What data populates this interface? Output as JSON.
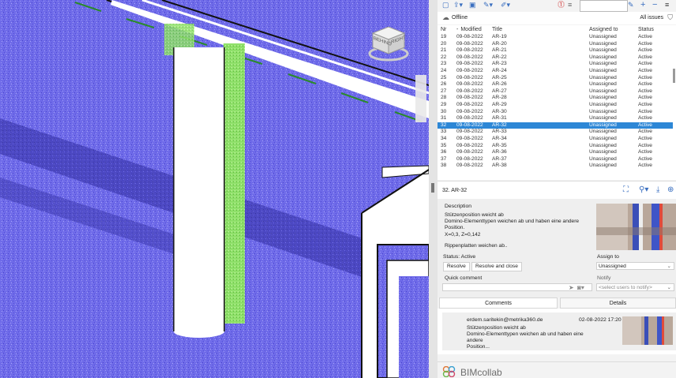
{
  "toolbar": {
    "search_value": "",
    "icons": [
      "new-issue-icon",
      "upload-icon",
      "save-icon",
      "pencil-icon",
      "pin-icon",
      "alert-icon",
      "list-icon",
      "edit-icon",
      "add-icon",
      "remove-icon",
      "menu-icon"
    ]
  },
  "status": {
    "connection": "Offline",
    "filter_label": "All issues"
  },
  "table": {
    "headers": [
      "Nr",
      "Modified",
      "Title",
      "Assigned to",
      "Status"
    ],
    "sort_indicator": "-",
    "rows": [
      [
        "19",
        "09-08-2022",
        "AR-19",
        "Unassigned",
        "Active"
      ],
      [
        "20",
        "09-08-2022",
        "AR-20",
        "Unassigned",
        "Active"
      ],
      [
        "21",
        "09-08-2022",
        "AR-21",
        "Unassigned",
        "Active"
      ],
      [
        "22",
        "09-08-2022",
        "AR-22",
        "Unassigned",
        "Active"
      ],
      [
        "23",
        "09-08-2022",
        "AR-23",
        "Unassigned",
        "Active"
      ],
      [
        "24",
        "09-08-2022",
        "AR-24",
        "Unassigned",
        "Active"
      ],
      [
        "25",
        "09-08-2022",
        "AR-25",
        "Unassigned",
        "Active"
      ],
      [
        "26",
        "09-08-2022",
        "AR-26",
        "Unassigned",
        "Active"
      ],
      [
        "27",
        "09-08-2022",
        "AR-27",
        "Unassigned",
        "Active"
      ],
      [
        "28",
        "09-08-2022",
        "AR-28",
        "Unassigned",
        "Active"
      ],
      [
        "29",
        "09-08-2022",
        "AR-29",
        "Unassigned",
        "Active"
      ],
      [
        "30",
        "09-08-2022",
        "AR-30",
        "Unassigned",
        "Active"
      ],
      [
        "31",
        "09-08-2022",
        "AR-31",
        "Unassigned",
        "Active"
      ],
      [
        "32",
        "09-08-2022",
        "AR-32",
        "Unassigned",
        "Active"
      ],
      [
        "33",
        "09-08-2022",
        "AR-33",
        "Unassigned",
        "Active"
      ],
      [
        "34",
        "09-08-2022",
        "AR-34",
        "Unassigned",
        "Active"
      ],
      [
        "35",
        "09-08-2022",
        "AR-35",
        "Unassigned",
        "Active"
      ],
      [
        "36",
        "09-08-2022",
        "AR-36",
        "Unassigned",
        "Active"
      ],
      [
        "37",
        "09-08-2022",
        "AR-37",
        "Unassigned",
        "Active"
      ],
      [
        "38",
        "09-08-2022",
        "AR-38",
        "Unassigned",
        "Active"
      ]
    ],
    "selected_row": "32"
  },
  "issue": {
    "title": "32. AR-32",
    "description_label": "Description",
    "description_lines": [
      "Stützenposition weicht ab",
      "Domino-Elementtypen weichen ab und haben eine andere",
      "Position.",
      "X=0,3, Z=0,142"
    ],
    "description_extra": "Rippenplatten  weichen  ab..",
    "status_label": "Status: Active",
    "resolve_label": "Resolve",
    "resolve_close_label": "Resolve and close",
    "assign_label": "Assign to",
    "assign_value": "Unassigned",
    "quick_comment_label": "Quick comment",
    "notify_label": "Notify",
    "notify_placeholder": "<select users to notify>"
  },
  "tabs": {
    "comments": "Comments",
    "details": "Details"
  },
  "comment": {
    "author": "erdem.saritekin@metrika360.de",
    "date": "02-08-2022 17:20",
    "lines": [
      "Stützenposition weicht ab",
      "Domino-Elementtypen weichen ab und haben eine andere",
      "Position..."
    ]
  },
  "viewcube": {
    "faces": [
      "BEHIND",
      "RIGHT"
    ]
  },
  "footer": {
    "brand": "BIMcollab"
  },
  "colors": {
    "accent": "#2d87d6",
    "cloud": "#6a66e8",
    "highlight": "#8ee86a"
  }
}
